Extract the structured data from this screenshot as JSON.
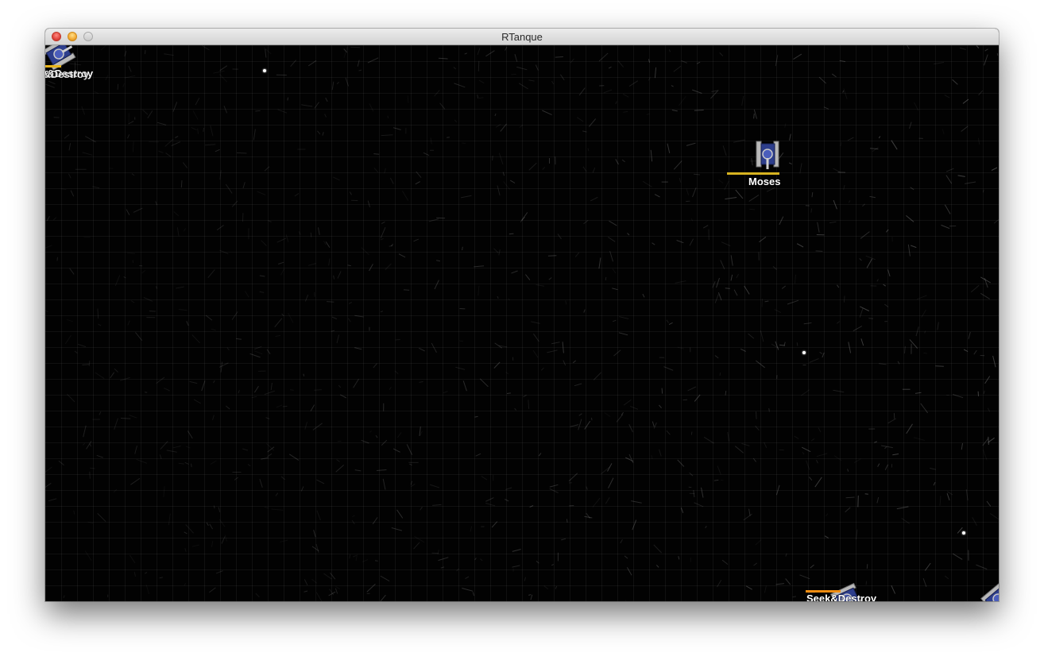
{
  "window": {
    "title": "RTanque"
  },
  "bots": [
    {
      "id": "seek-top-left",
      "name": "Seek&Destroy",
      "health": 0.45,
      "health_color": "#e8b41c"
    },
    {
      "id": "moses",
      "name": "Moses",
      "health": 0.9,
      "health_color": "#d7b321"
    },
    {
      "id": "seek-bottom",
      "name": "Seek&Destroy",
      "health": 0.5,
      "health_color": "#f08c10"
    },
    {
      "id": "offscreen-right",
      "name": "",
      "health": 0,
      "health_color": "#e8b41c"
    }
  ],
  "shells_visible": 3,
  "colors": {
    "arena": "#020202",
    "tank_body": "#2d3e8c",
    "tank_tread": "#b9b9b9",
    "name_text": "#ffffff"
  }
}
